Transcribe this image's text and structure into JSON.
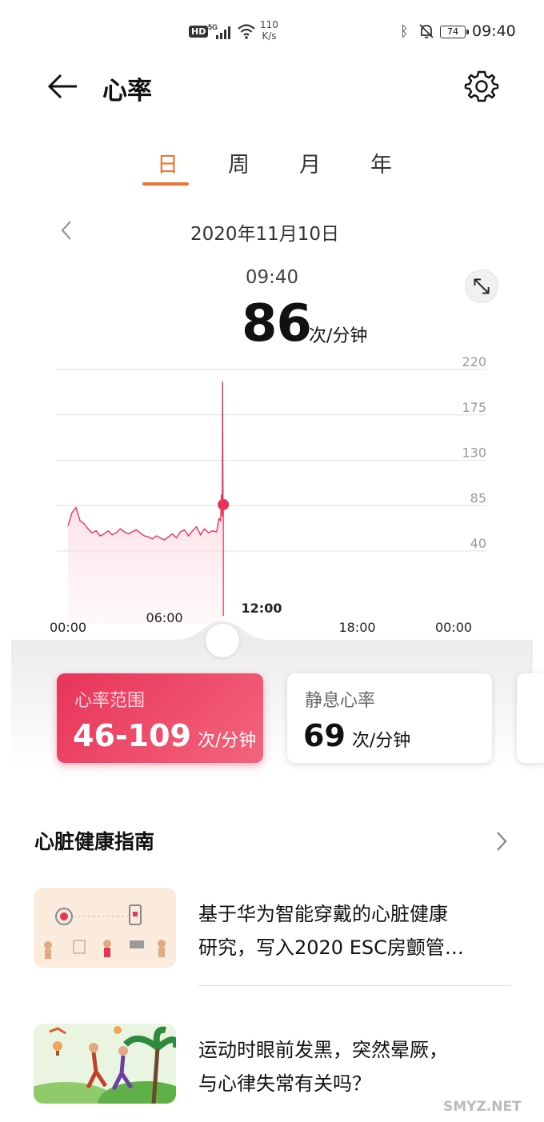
{
  "status_bar": {
    "hd": "HD",
    "net": "5G",
    "speed_value": "110",
    "speed_unit": "K/s",
    "battery": "74",
    "time": "09:40"
  },
  "header": {
    "title": "心率",
    "back_icon": "arrow-left-icon",
    "settings_icon": "gear-icon"
  },
  "tabs": [
    {
      "label": "日",
      "active": true
    },
    {
      "label": "周",
      "active": false
    },
    {
      "label": "月",
      "active": false
    },
    {
      "label": "年",
      "active": false
    }
  ],
  "date": "2020年11月10日",
  "reading": {
    "time": "09:40",
    "value": "86",
    "unit": "次/分钟"
  },
  "chart_data": {
    "type": "area",
    "y_ticks": [
      "220",
      "175",
      "130",
      "85",
      "40"
    ],
    "ylim": [
      40,
      220
    ],
    "x_ticks": [
      "00:00",
      "06:00",
      "12:00",
      "18:00",
      "00:00"
    ],
    "x_hours": [
      0,
      6,
      12,
      18,
      24
    ],
    "highlight_tick": "12:00",
    "series": [
      {
        "x": [
          0,
          0.25,
          0.5,
          0.75,
          1.0,
          1.25,
          1.5,
          1.75,
          2.0,
          2.25,
          2.5,
          2.75,
          3.0,
          3.25,
          3.5,
          3.75,
          4.0,
          4.25,
          4.5,
          4.75,
          5.0,
          5.25,
          5.5,
          5.75,
          6.0,
          6.25,
          6.5,
          6.75,
          7.0,
          7.25,
          7.5,
          7.75,
          8.0,
          8.25,
          8.5,
          8.75,
          9.0,
          9.25,
          9.4,
          9.5,
          9.55,
          9.6,
          9.62,
          9.65,
          9.67
        ],
        "y": [
          65,
          78,
          83,
          70,
          67,
          62,
          58,
          60,
          55,
          57,
          60,
          56,
          58,
          62,
          59,
          57,
          59,
          61,
          58,
          55,
          54,
          52,
          55,
          53,
          51,
          54,
          57,
          53,
          59,
          61,
          55,
          60,
          64,
          56,
          62,
          58,
          60,
          59,
          72,
          70,
          96,
          74,
          208,
          86,
          86
        ]
      }
    ],
    "current_point": {
      "x": 9.67,
      "y": 86
    },
    "grid": true,
    "color": "#E8345A"
  },
  "cards": [
    {
      "label": "心率范围",
      "value": "46-109",
      "unit": "次/分钟"
    },
    {
      "label": "静息心率",
      "value": "69",
      "unit": "次/分钟"
    }
  ],
  "guide": {
    "title": "心脏健康指南",
    "articles": [
      {
        "line1": "基于华为智能穿戴的心脏健康",
        "line2": "研究，写入2020 ESC房颤管…"
      },
      {
        "line1": "运动时眼前发黑，突然晕厥，",
        "line2": "与心律失常有关吗？"
      }
    ]
  },
  "watermark": "SMYZ.NET"
}
